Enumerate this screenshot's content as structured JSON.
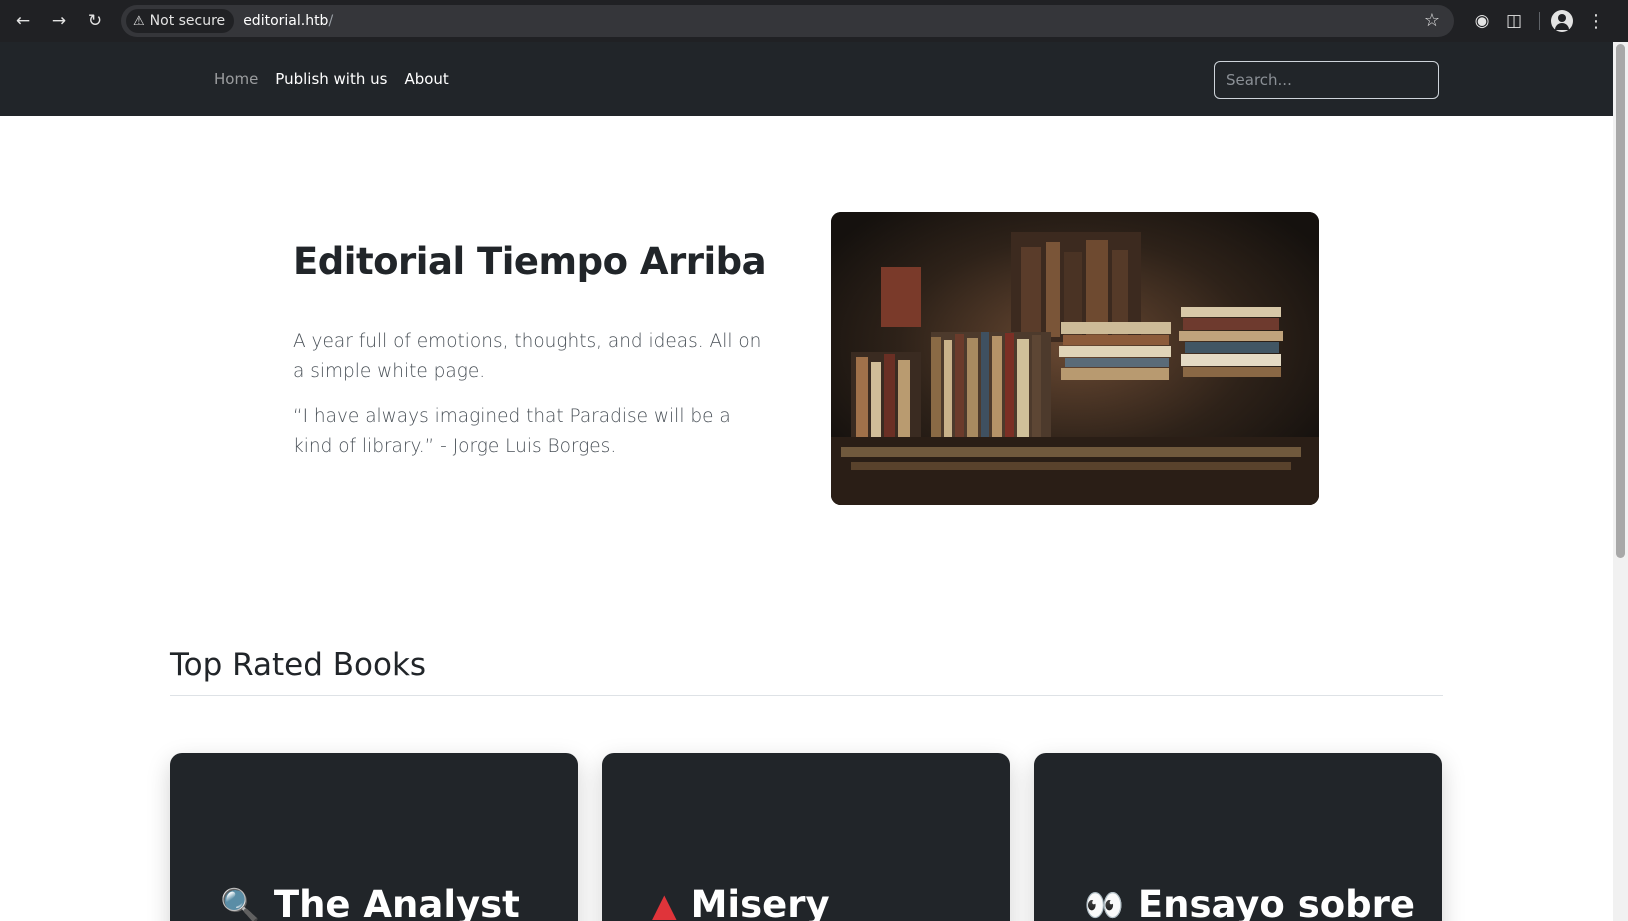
{
  "browser": {
    "security_label": "Not secure",
    "url_host": "editorial.htb",
    "url_path": "/",
    "icons": [
      "back-icon",
      "forward-icon",
      "reload-icon",
      "warning-icon",
      "star-icon",
      "extension-puzzle-icon",
      "profile-icon",
      "menu-kebab-icon"
    ]
  },
  "nav": {
    "links": [
      {
        "label": "Home",
        "active": true
      },
      {
        "label": "Publish with us",
        "active": false
      },
      {
        "label": "About",
        "active": false
      }
    ],
    "search_placeholder": "Search..."
  },
  "hero": {
    "title": "Editorial Tiempo Arriba",
    "lead": "A year full of emotions, thoughts, and ideas. All on a simple white page.",
    "quote": "“I have always imagined that Paradise will be a kind of library.” - Jorge Luis Borges."
  },
  "top_rated": {
    "heading": "Top Rated Books",
    "books": [
      {
        "icon": "🔍",
        "title": "The Analyst"
      },
      {
        "icon": "▲",
        "title": "Misery"
      },
      {
        "icon": "👀",
        "title": "Ensayo sobre"
      }
    ]
  },
  "colors": {
    "navbar": "#212529",
    "card": "#212529",
    "chrome": "#202124"
  }
}
